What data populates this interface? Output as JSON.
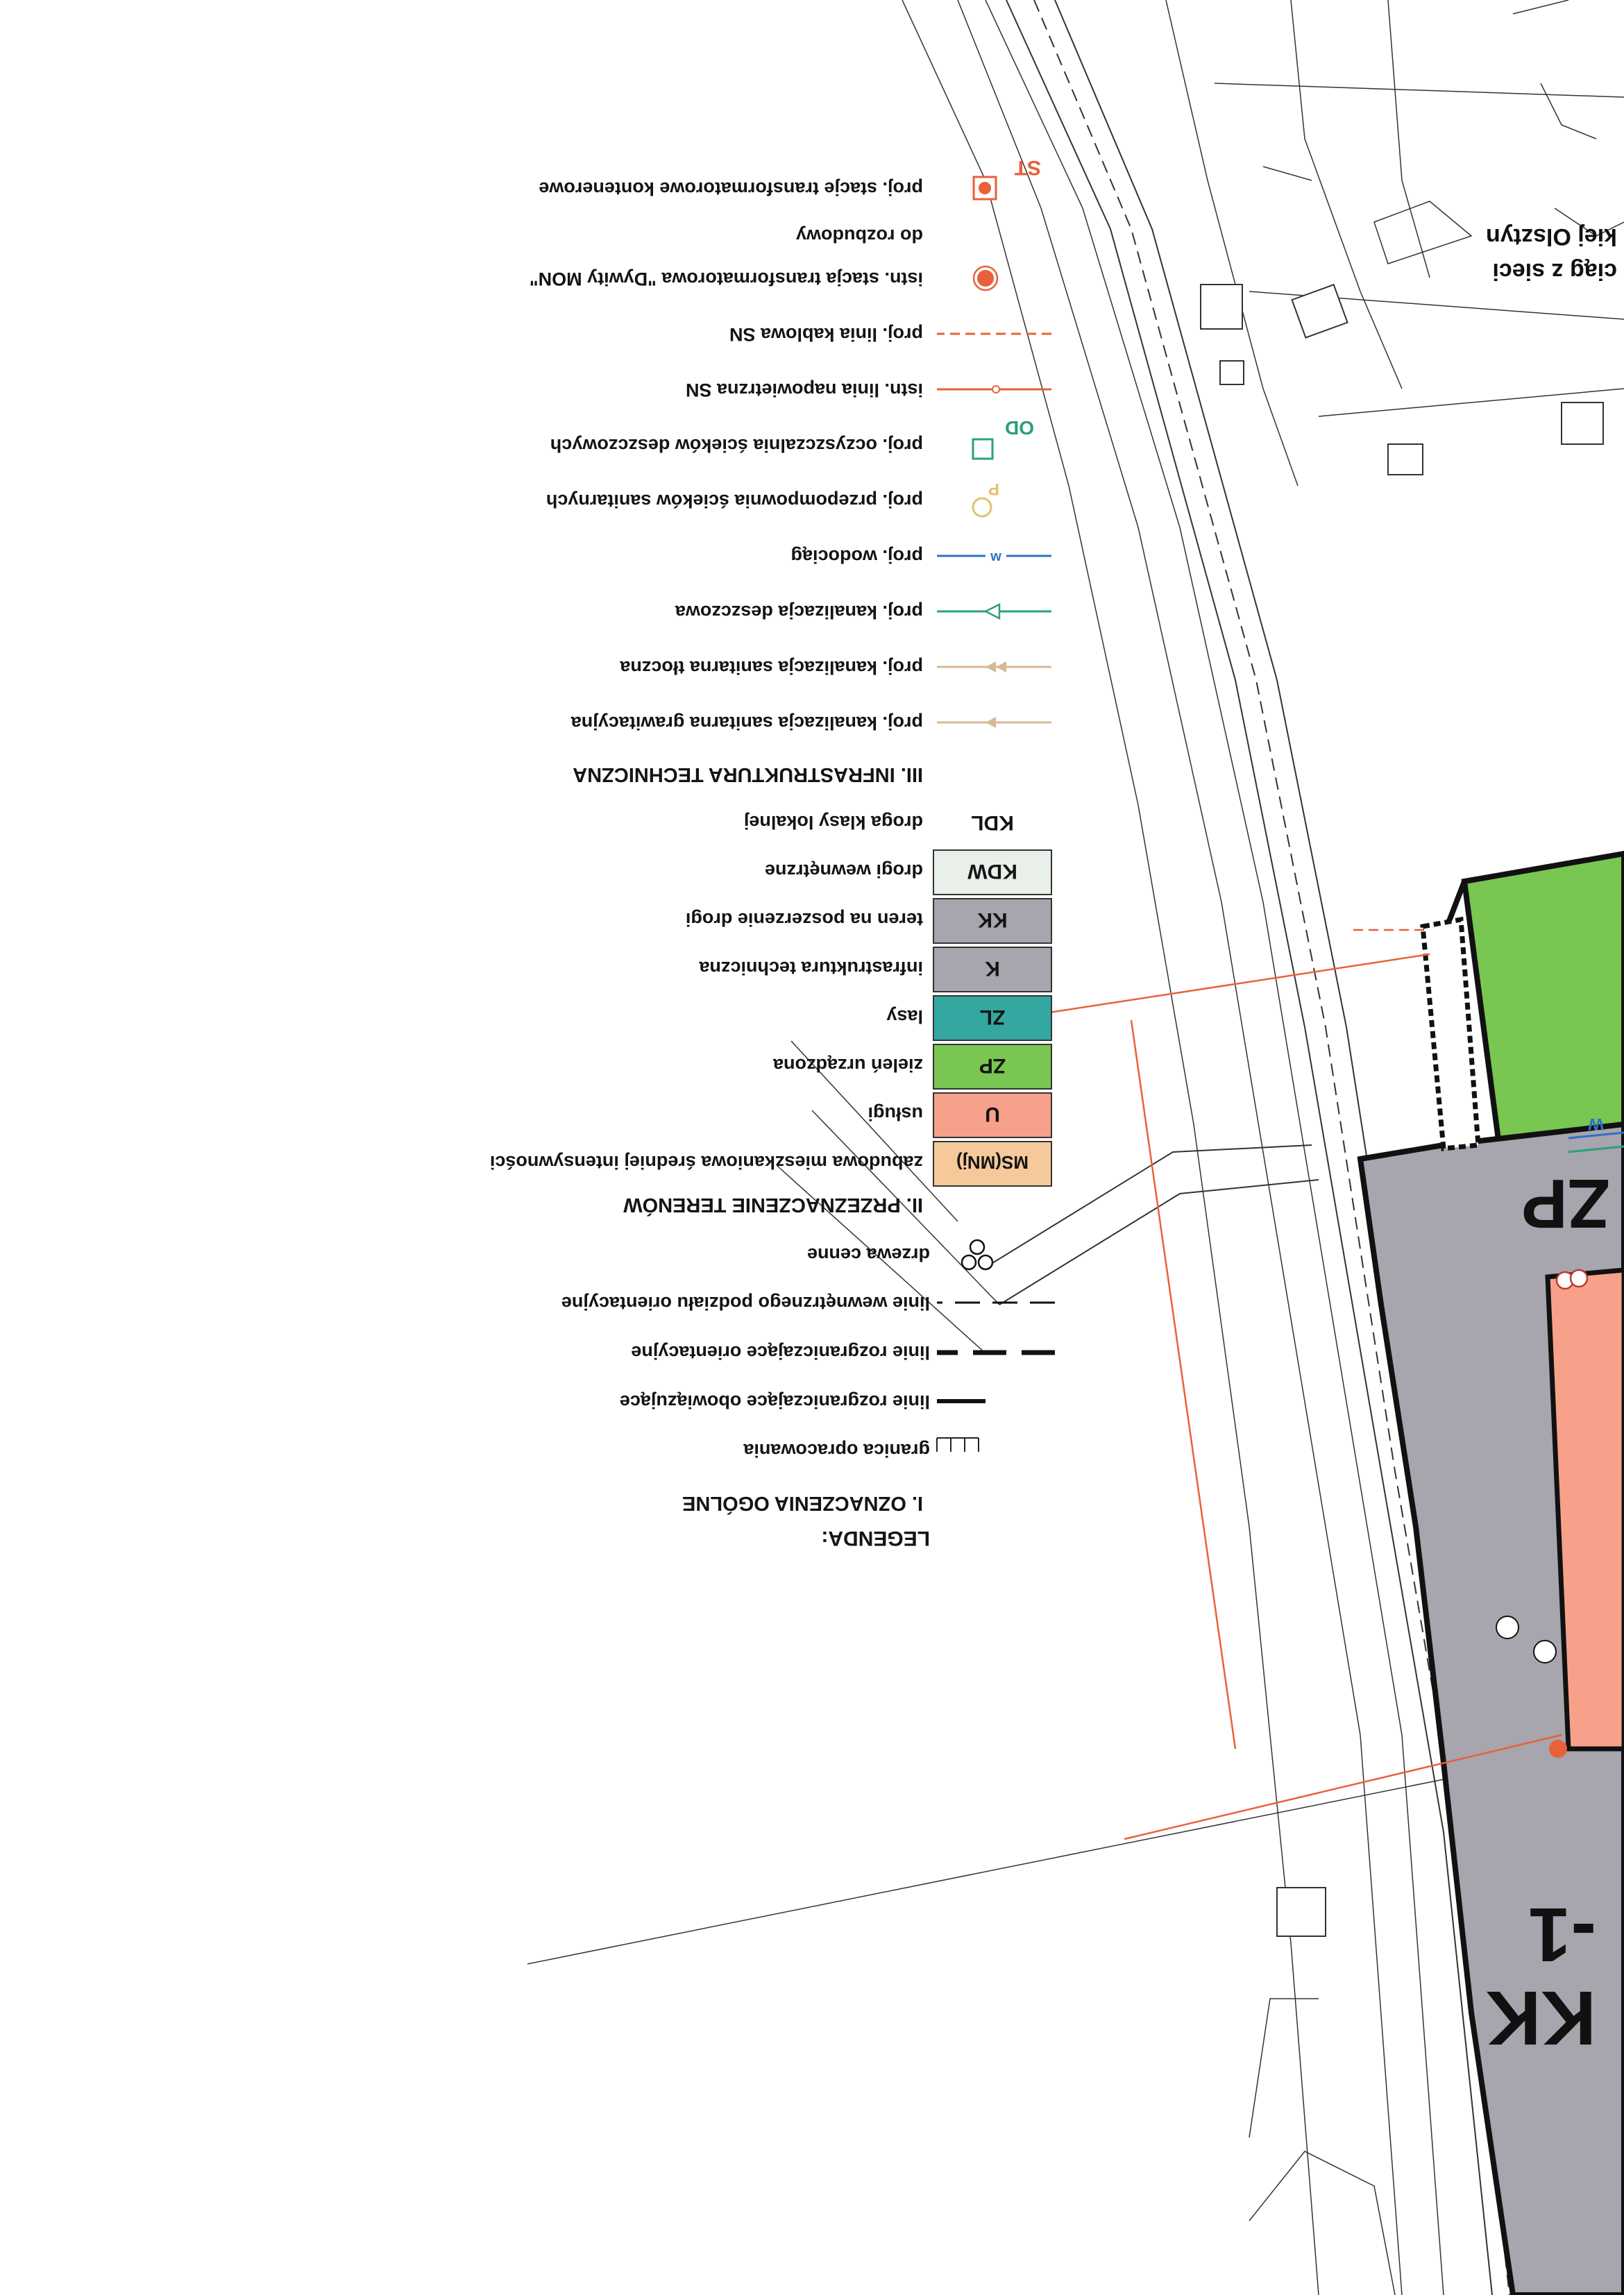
{
  "legend": {
    "title": "LEGENDA:",
    "section1": "I. OZNACZENIA OGÓLNE",
    "general": [
      {
        "label": "granica opracowania",
        "symbol": "boundary"
      },
      {
        "label": "linie rozgraniczające obowiązujące",
        "symbol": "mandatory-line"
      },
      {
        "label": "linie rozgraniczające orientacyjne",
        "symbol": "indicative-line"
      },
      {
        "label": "linie wewnętrznego podziału orientacyjne",
        "symbol": "internal-line"
      },
      {
        "label": "drzewa cenne",
        "symbol": "trees"
      }
    ],
    "section2": "II. PRZEZNACZENIE TERENÓW",
    "land_use": [
      {
        "code": "MS(MNj)",
        "label": "zabudowa mieszkaniowa średniej intensywności",
        "color": "#f6c99a"
      },
      {
        "code": "U",
        "label": "usługi",
        "color": "#f7a18b"
      },
      {
        "code": "ZP",
        "label": "zieleń urządzona",
        "color": "#79c652"
      },
      {
        "code": "ZL",
        "label": "lasy",
        "color": "#34a7a0"
      },
      {
        "code": "K",
        "label": "infrastruktura techniczna",
        "color": "#a7a5ad"
      },
      {
        "code": "KK",
        "label": "teren na poszerzenie drogi",
        "color": "#a7a5ad"
      },
      {
        "code": "KDW",
        "label": "drogi wewnętrzne",
        "color": "#e9f0ea"
      },
      {
        "code": "KDL",
        "label": "droga klasy lokalnej",
        "color": "#ffffff"
      }
    ],
    "section3": "III. INFRASTRUKTURA TECHNICZNA",
    "infrastructure": [
      {
        "label": "proj. kanalizacja sanitarna grawitacyjna",
        "color": "#d7b995",
        "symbol": "gravity-sewer"
      },
      {
        "label": "proj. kanalizacja sanitarna tłoczna",
        "color": "#d7b995",
        "symbol": "pressure-sewer"
      },
      {
        "label": "proj. kanalizacja deszczowa",
        "color": "#2aa07a",
        "symbol": "storm-sewer"
      },
      {
        "label": "proj. wodociąg",
        "color": "#2f6fc9",
        "symbol": "water-main"
      },
      {
        "label": "proj. przepompownia ścieków sanitarnych",
        "color": "#e2c36b",
        "symbol": "pump-station",
        "code": "P"
      },
      {
        "label": "proj. oczyszczalnia ścieków deszczowych",
        "color": "#2aa07a",
        "symbol": "treatment-plant",
        "code": "OD"
      },
      {
        "label": "istn. linia napowietrzna SN",
        "color": "#e8613a",
        "symbol": "overhead-line"
      },
      {
        "label": "proj. linia kablowa SN",
        "color": "#e8613a",
        "symbol": "cable-line"
      },
      {
        "label": "istn. stacja transformatorowa \"Dywity MON\"",
        "label2": "do rozbudowy",
        "color": "#e8613a",
        "symbol": "existing-station"
      },
      {
        "label": "proj. stacje transformatorowe kontenerowe",
        "color": "#e8613a",
        "symbol": "container-station",
        "code": "ST"
      }
    ]
  },
  "map": {
    "zone_label_kk": "KK",
    "zone_label_kk_num": "-1",
    "zone_label_zp": "ZP",
    "network_note": "ciąg z sieci",
    "network_note2": "kiej Olsztyn",
    "pipe_code": "W"
  },
  "colors": {
    "road_grey": "#a7a5ad",
    "services": "#f7a18b",
    "green": "#79c652",
    "power": "#e8613a",
    "water": "#2f6fc9",
    "storm": "#2aa07a"
  }
}
